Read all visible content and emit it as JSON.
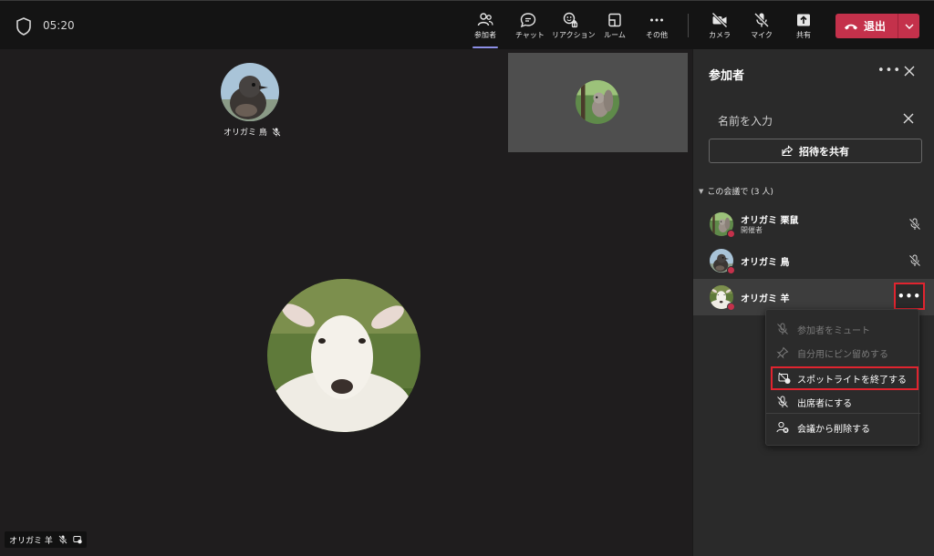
{
  "topbar": {
    "timer": "05:20",
    "buttons": {
      "participants": "参加者",
      "chat": "チャット",
      "reactions": "リアクション",
      "rooms": "ルーム",
      "more": "その他",
      "camera": "カメラ",
      "mic": "マイク",
      "share": "共有"
    },
    "leave_label": "退出"
  },
  "stage": {
    "top_participant_name": "オリガミ 鳥",
    "bottom_participant_name": "オリガミ 羊"
  },
  "panel": {
    "title": "参加者",
    "more": "•••",
    "search_placeholder": "名前を入力",
    "share_invite_label": "招待を共有",
    "section_label": "この会議で (3 人)",
    "participants": [
      {
        "name": "オリガミ 栗鼠",
        "role": "開催者"
      },
      {
        "name": "オリガミ 鳥"
      },
      {
        "name": "オリガミ 羊",
        "more": "•••"
      }
    ]
  },
  "context_menu": {
    "items": [
      {
        "label": "参加者をミュート"
      },
      {
        "label": "自分用にピン留めする"
      },
      {
        "label": "スポットライトを終了する"
      },
      {
        "label": "出席者にする"
      },
      {
        "label": "会議から削除する"
      }
    ]
  },
  "colors": {
    "accent": "#8c8fe6",
    "leave": "#c4314b",
    "highlight_box": "#e0242f",
    "status_dot": "#c4314b"
  }
}
